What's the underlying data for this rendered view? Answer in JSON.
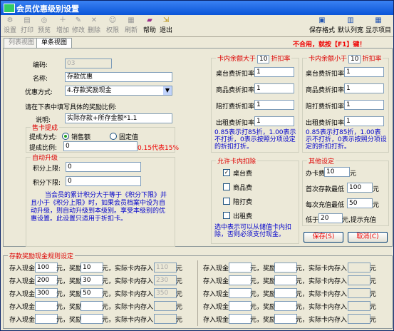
{
  "window": {
    "title": "会员优惠级别设置"
  },
  "toolbar": {
    "items": [
      {
        "label": "设置",
        "icon": "settings-icon",
        "enabled": false
      },
      {
        "label": "打印",
        "icon": "print-icon",
        "enabled": false
      },
      {
        "label": "预览",
        "icon": "preview-icon",
        "enabled": false
      },
      {
        "label": "增加",
        "icon": "add-icon",
        "enabled": false
      },
      {
        "label": "修改",
        "icon": "edit-icon",
        "enabled": false
      },
      {
        "label": "删除",
        "icon": "delete-icon",
        "enabled": false
      },
      {
        "label": "权限",
        "icon": "permission-icon",
        "enabled": false
      },
      {
        "label": "刷新",
        "icon": "refresh-icon",
        "enabled": false
      },
      {
        "label": "帮助",
        "icon": "help-icon",
        "enabled": true
      },
      {
        "label": "退出",
        "icon": "exit-icon",
        "enabled": true
      }
    ],
    "right_items": [
      {
        "label": "保存格式",
        "icon": "save-format-icon"
      },
      {
        "label": "默认列宽",
        "icon": "column-width-icon"
      },
      {
        "label": "显示项目",
        "icon": "display-items-icon"
      }
    ]
  },
  "tabs": [
    {
      "label": "列表视图"
    },
    {
      "label": "单条视图"
    }
  ],
  "warning": "不合用，就按【F1】键！",
  "form": {
    "code_label": "编码:",
    "code_value": "03",
    "name_label": "名称:",
    "name_value": "存款优惠",
    "method_label": "优惠方式:",
    "method_value": "4.存款奖励现金",
    "hint": "请在下表中填写具体的奖励比例:",
    "desc_label": "说明:",
    "desc_value": "实际存款+所存金额*1.1"
  },
  "sale": {
    "caption": "售卡提成",
    "mode_label": "提成方式:",
    "opt1": "销售额",
    "opt2": "固定值",
    "ratio_label": "提成比例:",
    "ratio_value": "0",
    "ratio_hint": "0.15代表15%"
  },
  "upgrade": {
    "caption": "自动升级",
    "upper_label": "积分上限:",
    "upper_value": "0",
    "lower_label": "积分下限:",
    "lower_value": "0",
    "note": "当会员的累计积分大于等于《积分下限》并且小于《积分上限》时，如果会员档案中设为自动升级，则自动升级到本级别。享受本级别的优惠设置。此设置只适用于折扣卡。"
  },
  "above": {
    "caption_pre": "卡内余额大于",
    "caption_val": "10",
    "caption_post": "折扣率",
    "rows": [
      {
        "label": "桌台费折扣率:",
        "value": "1"
      },
      {
        "label": "商品费折扣率:",
        "value": "1"
      },
      {
        "label": "陪打费折扣率:",
        "value": "1"
      },
      {
        "label": "出租费折扣率:",
        "value": "1"
      }
    ],
    "note": "0.85表示打85折，1.00表示不打折，0表示按照分项设定的折扣打折。"
  },
  "below": {
    "caption_pre": "卡内余额小于",
    "caption_val": "10",
    "caption_post": "折扣率",
    "rows": [
      {
        "label": "桌台费折扣率:",
        "value": "1"
      },
      {
        "label": "商品费折扣率:",
        "value": "1"
      },
      {
        "label": "陪打费折扣率:",
        "value": "1"
      },
      {
        "label": "出租费折扣率:",
        "value": "1"
      }
    ],
    "note": "0.85表示打85折，1.00表示不打折，0表示按照分项设定的折扣打折。"
  },
  "deduct": {
    "caption": "允许卡内扣除",
    "items": [
      {
        "label": "桌台费",
        "checked": true
      },
      {
        "label": "商品费",
        "checked": false
      },
      {
        "label": "陪打费",
        "checked": false
      },
      {
        "label": "出租费",
        "checked": false
      }
    ],
    "note": "选中表示可以从储值卡内扣除，否则必须支付现金。"
  },
  "other": {
    "caption": "其他设定",
    "fee_label": "办卡费",
    "fee_value": "10",
    "yuan": "元",
    "min_dep_label": "首次存款最低",
    "min_dep_value": "100",
    "min_rec_label": "每次充值最低",
    "min_rec_value": "50",
    "low_label": "低于",
    "low_value": "20",
    "low_post": "元,提示充值"
  },
  "buttons": {
    "save": "保存(S)",
    "cancel": "取消(C)"
  },
  "rules": {
    "caption": "存款奖励现金规则设定",
    "t1": "存入现金",
    "t2": "元，奖励",
    "t3": "元，实际卡内存入",
    "t4": "元",
    "left": [
      {
        "deposit": "100",
        "bonus": "10",
        "actual": "110"
      },
      {
        "deposit": "200",
        "bonus": "30",
        "actual": "230"
      },
      {
        "deposit": "300",
        "bonus": "50",
        "actual": "350"
      },
      {
        "deposit": "",
        "bonus": "",
        "actual": ""
      },
      {
        "deposit": "",
        "bonus": "",
        "actual": ""
      }
    ],
    "right": [
      {
        "deposit": "",
        "bonus": "",
        "actual": ""
      },
      {
        "deposit": "",
        "bonus": "",
        "actual": ""
      },
      {
        "deposit": "",
        "bonus": "",
        "actual": ""
      },
      {
        "deposit": "",
        "bonus": "",
        "actual": ""
      },
      {
        "deposit": "",
        "bonus": "",
        "actual": ""
      }
    ]
  }
}
